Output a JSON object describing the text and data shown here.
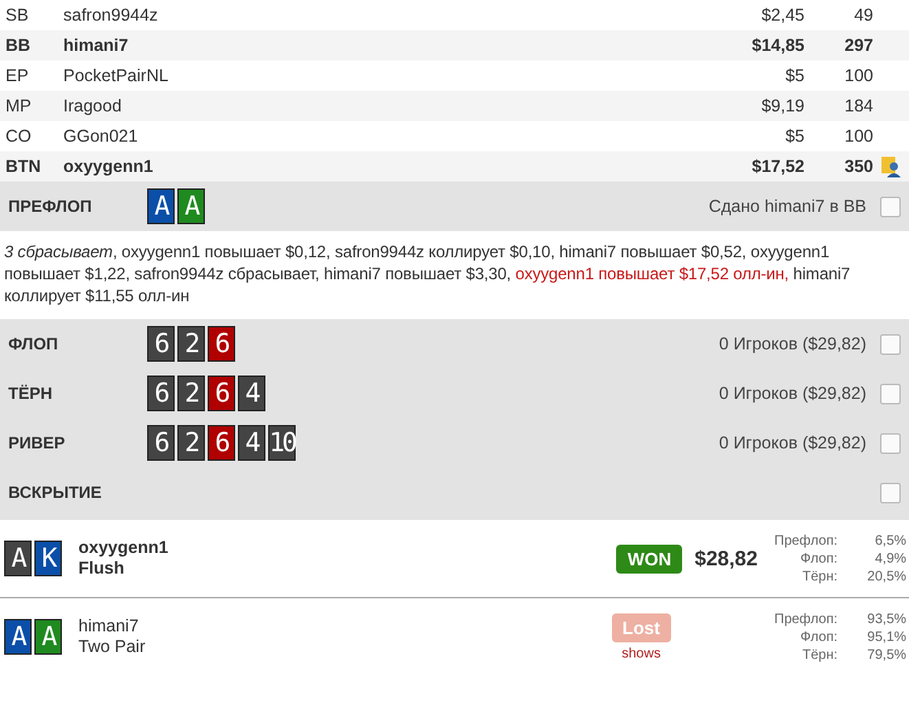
{
  "players": [
    {
      "position": "SB",
      "name": "safron9944z",
      "stack": "$2,45",
      "bb": "49",
      "bold": false,
      "dealer": false
    },
    {
      "position": "BB",
      "name": "himani7",
      "stack": "$14,85",
      "bb": "297",
      "bold": true,
      "dealer": false
    },
    {
      "position": "EP",
      "name": "PocketPairNL",
      "stack": "$5",
      "bb": "100",
      "bold": false,
      "dealer": false
    },
    {
      "position": "MP",
      "name": "Iragood",
      "stack": "$9,19",
      "bb": "184",
      "bold": false,
      "dealer": false
    },
    {
      "position": "CO",
      "name": "GGon021",
      "stack": "$5",
      "bb": "100",
      "bold": false,
      "dealer": false
    },
    {
      "position": "BTN",
      "name": "oxyygenn1",
      "stack": "$17,52",
      "bb": "350",
      "bold": true,
      "dealer": true
    }
  ],
  "preflop": {
    "title": "ПРЕФЛОП",
    "cards": [
      {
        "rank": "A",
        "color": "#0b4fa8"
      },
      {
        "rank": "A",
        "color": "#1f8a1f"
      }
    ],
    "info": "Сдано himani7 в BB",
    "checked": false,
    "actions": [
      {
        "kind": "folds",
        "text": "3 сбрасывает"
      },
      {
        "kind": "plain",
        "text": ", oxyygenn1 повышает $0,12, safron9944z коллирует $0,10, himani7 повышает $0,52, oxyygenn1 повышает $1,22, safron9944z сбрасывает, himani7 повышает $3,30, "
      },
      {
        "kind": "allin",
        "text": "oxyygenn1 повышает $17,52 олл-ин,"
      },
      {
        "kind": "plain",
        "text": " himani7 коллирует $11,55 олл-ин"
      }
    ]
  },
  "streets": [
    {
      "title": "ФЛОП",
      "cards": [
        {
          "rank": "6",
          "color": "#444444"
        },
        {
          "rank": "2",
          "color": "#444444"
        },
        {
          "rank": "6",
          "color": "#b00000"
        }
      ],
      "info": "0 Игроков ($29,82)",
      "checked": false
    },
    {
      "title": "ТЁРН",
      "cards": [
        {
          "rank": "6",
          "color": "#444444"
        },
        {
          "rank": "2",
          "color": "#444444"
        },
        {
          "rank": "6",
          "color": "#b00000"
        },
        {
          "rank": "4",
          "color": "#444444"
        }
      ],
      "info": "0 Игроков ($29,82)",
      "checked": false
    },
    {
      "title": "РИВЕР",
      "cards": [
        {
          "rank": "6",
          "color": "#444444"
        },
        {
          "rank": "2",
          "color": "#444444"
        },
        {
          "rank": "6",
          "color": "#b00000"
        },
        {
          "rank": "4",
          "color": "#444444"
        },
        {
          "rank": "10",
          "color": "#444444"
        }
      ],
      "info": "0 Игроков ($29,82)",
      "checked": false
    },
    {
      "title": "ВСКРЫТИЕ",
      "checked": false
    }
  ],
  "showdown": [
    {
      "cards": [
        {
          "rank": "A",
          "color": "#444444"
        },
        {
          "rank": "K",
          "color": "#0b4fa8"
        }
      ],
      "name": "oxyygenn1",
      "hand": "Flush",
      "bold": true,
      "won": true,
      "badge": "WON",
      "amount": "$28,82",
      "equity": [
        {
          "label": "Префлоп:",
          "value": "6,5%"
        },
        {
          "label": "Флоп:",
          "value": "4,9%"
        },
        {
          "label": "Тёрн:",
          "value": "20,5%"
        }
      ]
    },
    {
      "cards": [
        {
          "rank": "A",
          "color": "#0b4fa8"
        },
        {
          "rank": "A",
          "color": "#1f8a1f"
        }
      ],
      "name": "himani7",
      "hand": "Two Pair",
      "bold": false,
      "won": false,
      "badge": "Lost",
      "note": "shows",
      "equity": [
        {
          "label": "Префлоп:",
          "value": "93,5%"
        },
        {
          "label": "Флоп:",
          "value": "95,1%"
        },
        {
          "label": "Тёрн:",
          "value": "79,5%"
        }
      ]
    }
  ]
}
